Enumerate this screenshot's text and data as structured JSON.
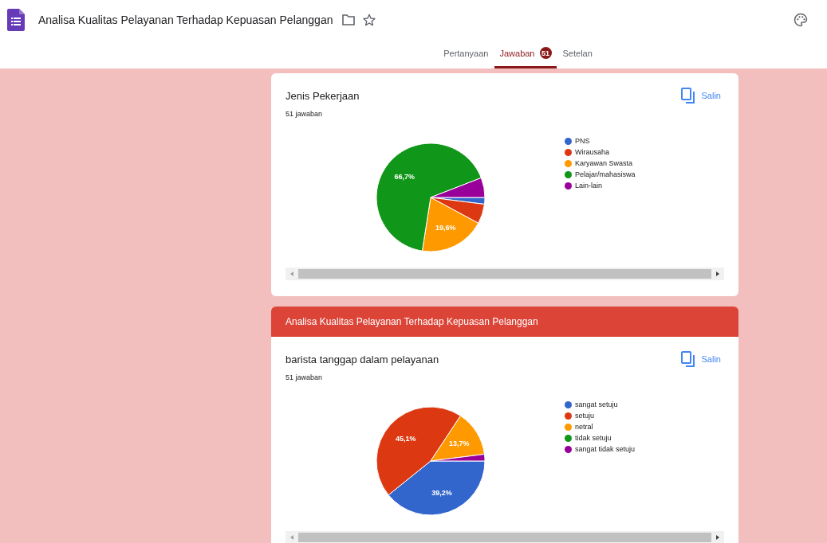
{
  "header": {
    "title": "Analisa Kualitas Pelayanan Terhadap Kepuasan Pelanggan"
  },
  "tabs": [
    {
      "label": "Pertanyaan",
      "selected": false
    },
    {
      "label": "Jawaban",
      "selected": true,
      "badge": "51"
    },
    {
      "label": "Setelan",
      "selected": false
    }
  ],
  "sections": [
    {
      "kind": "question",
      "title": "Jenis Pekerjaan",
      "count": "51 jawaban",
      "copy_label": "Salin",
      "chart_data": {
        "type": "pie",
        "categories": [
          "PNS",
          "Wirausaha",
          "Karyawan Swasta",
          "Pelajar/mahasiswa",
          "Lain-lain"
        ],
        "colors": [
          "#3366cc",
          "#dc3912",
          "#ff9900",
          "#109618",
          "#990099"
        ],
        "values": [
          2.0,
          5.9,
          19.6,
          66.7,
          5.9
        ],
        "value_labels": [
          null,
          null,
          "19,6%",
          "66,7%",
          null
        ],
        "legend": "right"
      }
    },
    {
      "kind": "section_header",
      "title": "Analisa Kualitas Pelayanan Terhadap Kepuasan Pelanggan"
    },
    {
      "kind": "question",
      "title": "barista tanggap dalam pelayanan",
      "count": "51 jawaban",
      "copy_label": "Salin",
      "chart_data": {
        "type": "pie",
        "categories": [
          "sangat setuju",
          "setuju",
          "netral",
          "tidak setuju",
          "sangat tidak setuju"
        ],
        "colors": [
          "#3366cc",
          "#dc3912",
          "#ff9900",
          "#109618",
          "#990099"
        ],
        "values": [
          39.2,
          45.1,
          13.7,
          0,
          2.0
        ],
        "value_labels": [
          "39,2%",
          "45,1%",
          "13,7%",
          null,
          null
        ],
        "legend": "right"
      }
    }
  ]
}
